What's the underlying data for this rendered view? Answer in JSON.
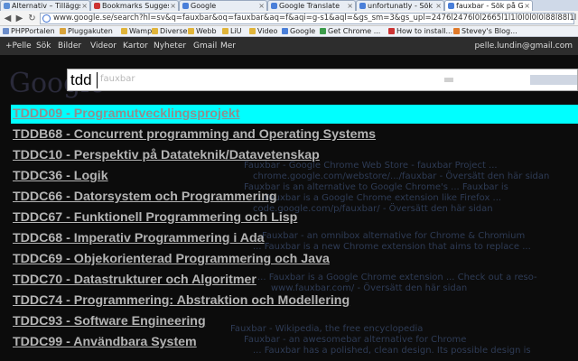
{
  "tabs": [
    {
      "title": "Alternativ – Tilläggsprogram",
      "active": false,
      "color": "#5b8ed6"
    },
    {
      "title": "Bookmarks Suggest",
      "active": false,
      "color": "#cc3333"
    },
    {
      "title": "Google",
      "active": false,
      "color": "#4a7fd9"
    },
    {
      "title": "Google Translate",
      "active": false,
      "color": "#4a7fd9"
    },
    {
      "title": "unfortunatly - Sök på",
      "active": false,
      "color": "#4a7fd9"
    },
    {
      "title": "fauxbar - Sök på Go",
      "active": true,
      "color": "#4a7fd9"
    }
  ],
  "toolbar": {
    "url": "www.google.se/search?hl=sv&q=fauxbar&oq=fauxbar&aq=f&aqi=g-s1&aql=&gs_sm=3&gs_upl=2476l2476l0l2665l1l1l0l0l0l0l88l88l1l"
  },
  "bookmarks": [
    {
      "label": "PHPPortalen",
      "color": "#6b8cc9"
    },
    {
      "label": "Pluggakuten",
      "color": "#d9a33a"
    },
    {
      "label": "Wamp",
      "color": "#e0b43a"
    },
    {
      "label": "Diverse",
      "color": "#e0b43a"
    },
    {
      "label": "Webb",
      "color": "#e0b43a"
    },
    {
      "label": "LiU",
      "color": "#e0b43a"
    },
    {
      "label": "Video",
      "color": "#e0b43a"
    },
    {
      "label": "Google",
      "color": "#4a7fd9"
    },
    {
      "label": "Get Chrome ...",
      "color": "#3b9b4a"
    },
    {
      "label": "How to install...",
      "color": "#cc3333"
    },
    {
      "label": "Stevey's Blog...",
      "color": "#e07a2a"
    }
  ],
  "gbar": {
    "links": [
      "+Pelle",
      "Sök",
      "Bilder",
      "Videor",
      "Kartor",
      "Nyheter",
      "Gmail",
      "Mer"
    ],
    "account": "pelle.lundin@gmail.com"
  },
  "page": {
    "logo": "Google",
    "snippets": [
      "Fauxbar - Google Chrome Web Store - fauxbar Project ...",
      "chrome.google.com/webstore/.../fauxbar - Översätt den här sidan",
      "Fauxbar is an alternative to Google Chrome's ... Fauxbar is",
      "... Fauxbar is a Google Chrome extension like Firefox ...",
      "code.google.com/p/fauxbar/ - Översätt den här sidan",
      "Fauxbar - an omnibox alternative for Chrome & Chromium",
      "... Fauxbar is a new Chrome extension that aims to replace ...",
      "... Fauxbar is a Google Chrome extension ... Check out a reso-",
      "www.fauxbar.com/ - Översätt den här sidan",
      "Fauxbar - Wikipedia, the free encyclopedia",
      "Fauxbar - an awesomebar alternative for Chrome",
      "... Fauxbar has a polished, clean design. Its possible design is"
    ]
  },
  "overlay": {
    "typed": "tdd",
    "ghost": "fauxbar"
  },
  "suggestions": [
    {
      "text": "TDDD09 - Programutvecklingsprojekt",
      "selected": true
    },
    {
      "text": "TDDB68 - Concurrent programming and Operating Systems",
      "selected": false
    },
    {
      "text": "TDDC10 - Perspektiv på Datateknik/Datavetenskap",
      "selected": false
    },
    {
      "text": "TDDC36 - Logik",
      "selected": false
    },
    {
      "text": "TDDC66 - Datorsystem och Programmering",
      "selected": false
    },
    {
      "text": "TDDC67 - Funktionell Programmering och Lisp",
      "selected": false
    },
    {
      "text": "TDDC68 - Imperativ Programmering i Ada",
      "selected": false
    },
    {
      "text": "TDDC69 - Objekorienterad Programmering och Java",
      "selected": false
    },
    {
      "text": "TDDC70 - Datastrukturer och Algoritmer",
      "selected": false
    },
    {
      "text": "TDDC74 - Programmering: Abstraktion och Modellering",
      "selected": false
    },
    {
      "text": "TDDC93 - Software Engineering",
      "selected": false
    },
    {
      "text": "TDDC99 - Användbara System",
      "selected": false
    }
  ]
}
